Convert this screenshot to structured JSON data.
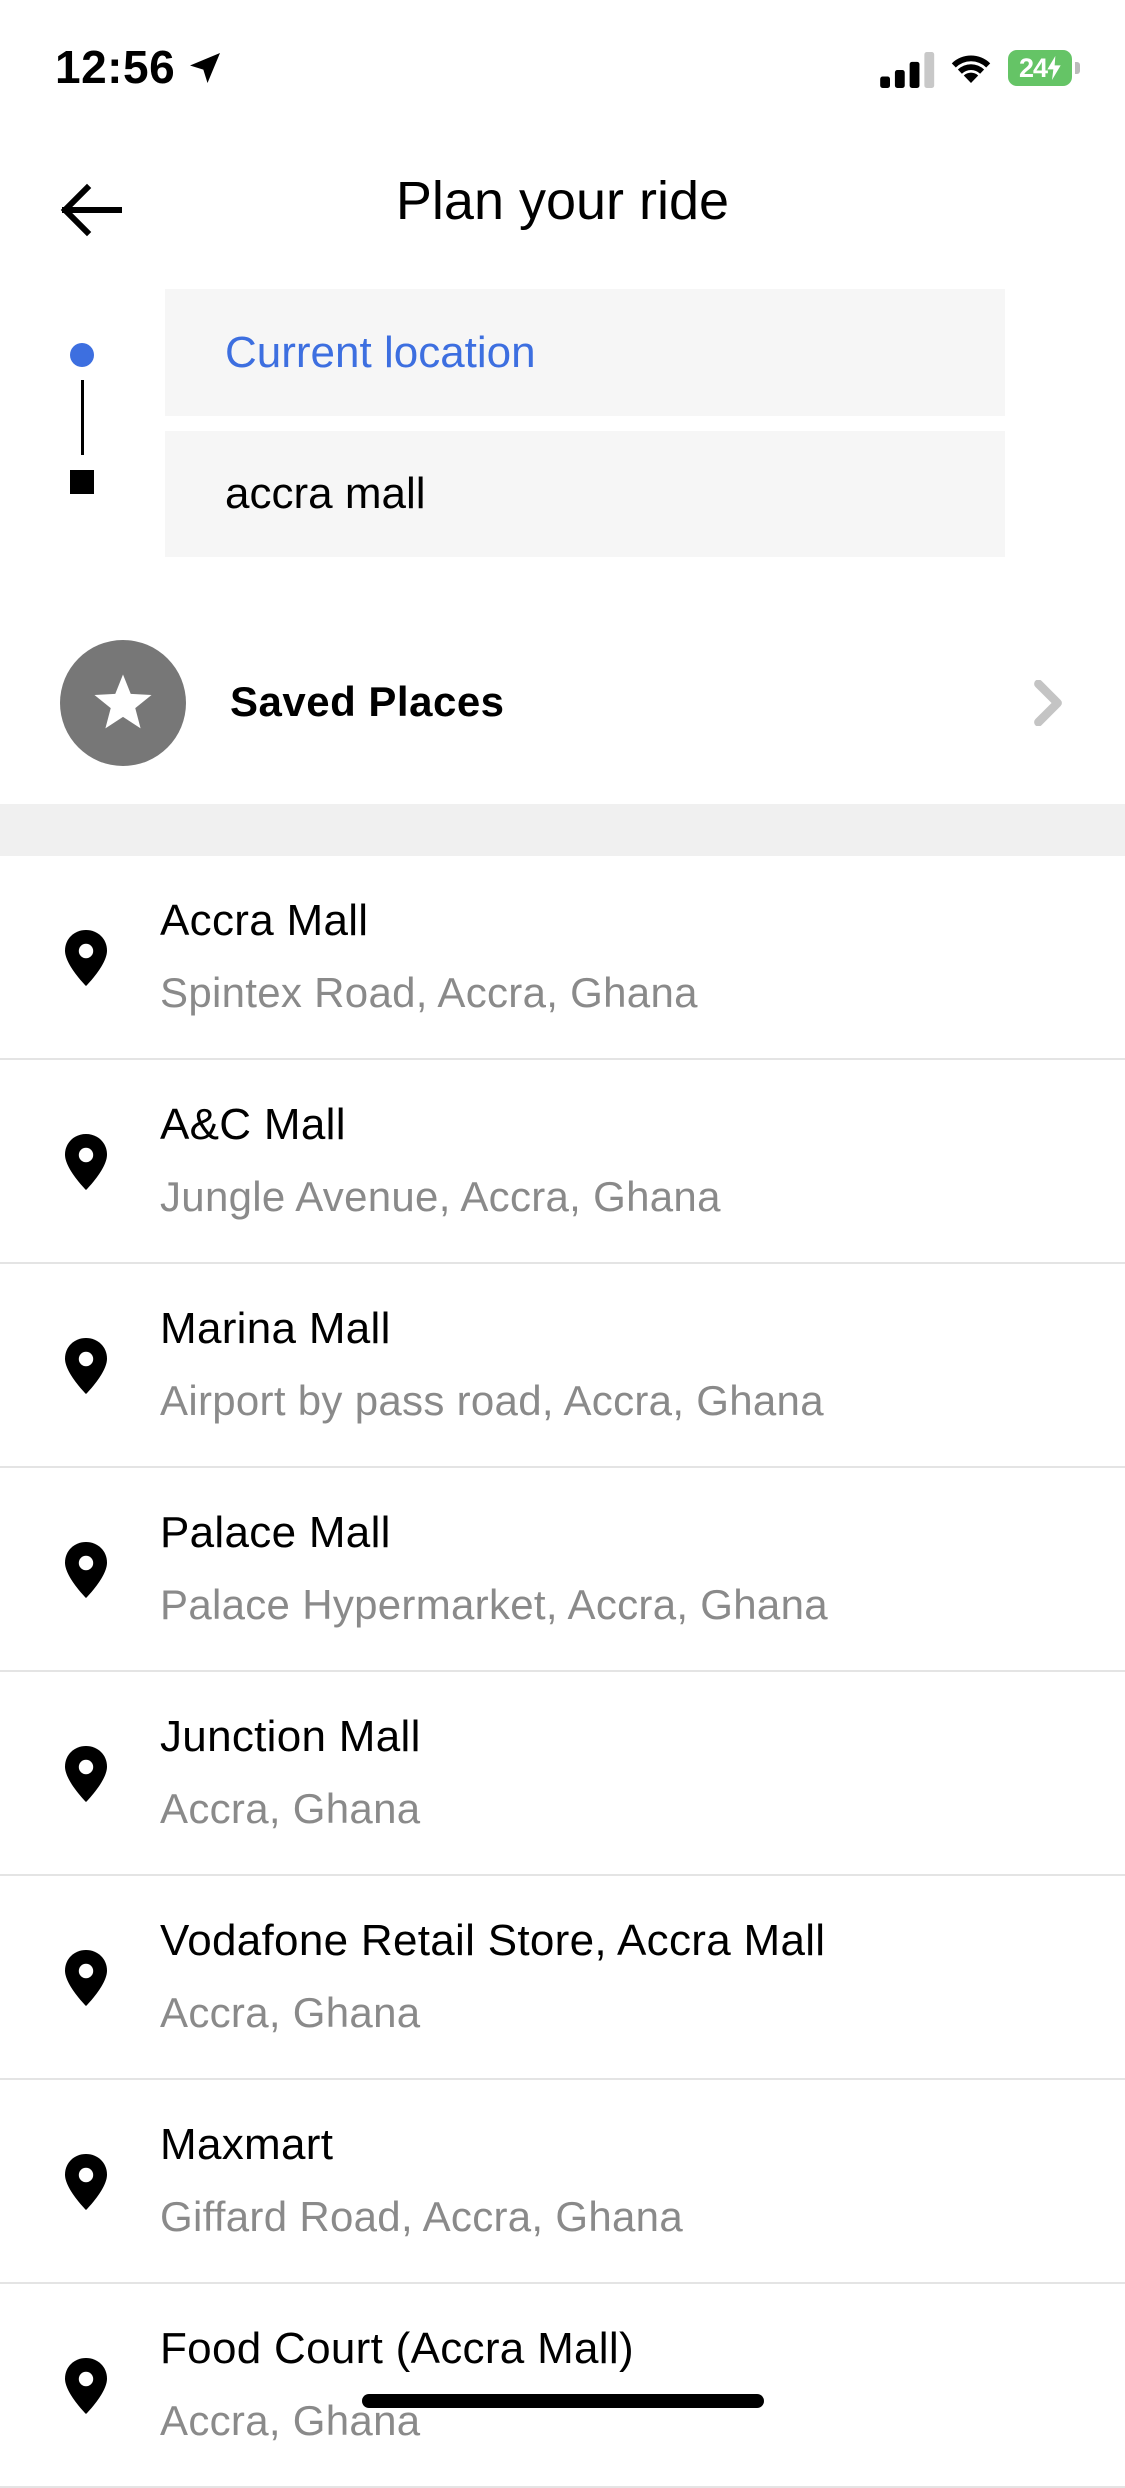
{
  "status_bar": {
    "time": "12:56",
    "battery_level": "24",
    "icons": [
      "location-arrow-icon",
      "signal-icon",
      "wifi-icon",
      "battery-icon"
    ]
  },
  "header": {
    "title": "Plan your ride",
    "back_icon": "arrow-left-icon"
  },
  "route": {
    "pickup_placeholder": "Current location",
    "dropoff_value": "accra mall"
  },
  "saved_places": {
    "label": "Saved Places",
    "icon": "star-icon"
  },
  "results": [
    {
      "title": "Accra Mall",
      "subtitle": "Spintex Road, Accra, Ghana"
    },
    {
      "title": "A&C Mall",
      "subtitle": "Jungle Avenue, Accra, Ghana"
    },
    {
      "title": "Marina Mall",
      "subtitle": "Airport by pass road, Accra, Ghana"
    },
    {
      "title": "Palace Mall",
      "subtitle": "Palace Hypermarket, Accra, Ghana"
    },
    {
      "title": "Junction Mall",
      "subtitle": "Accra, Ghana"
    },
    {
      "title": "Vodafone Retail Store, Accra Mall",
      "subtitle": "Accra, Ghana"
    },
    {
      "title": "Maxmart",
      "subtitle": "Giffard Road, Accra, Ghana"
    },
    {
      "title": "Food Court (Accra Mall)",
      "subtitle": "Accra, Ghana"
    }
  ],
  "colors": {
    "accent": "#3d6fe0",
    "battery": "#65c466",
    "saved_circle": "#777777",
    "subtitle": "#8a8a8a"
  }
}
